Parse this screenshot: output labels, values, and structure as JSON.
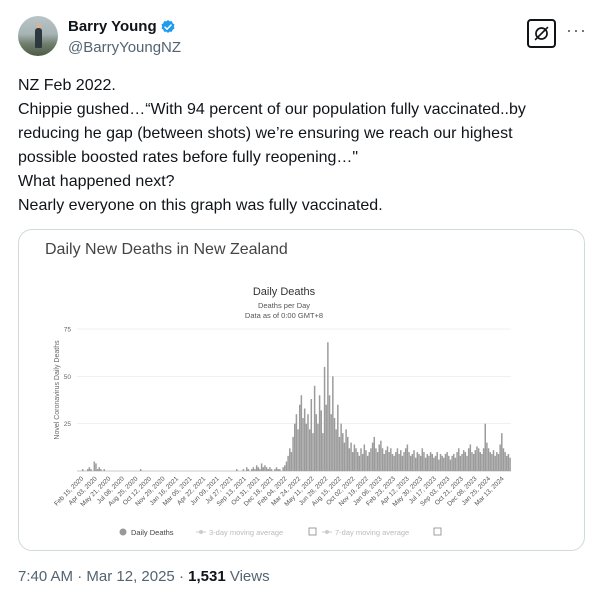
{
  "author": {
    "name": "Barry Young",
    "handle": "@BarryYoungNZ",
    "verified": true
  },
  "tweet": {
    "lines": [
      "NZ Feb 2022.",
      "Chippie gushed…“With 94 percent of our population fully vaccinated..by",
      "reducing he gap (between shots) we’re ensuring we reach our highest",
      "possible boosted rates before fully reopening…\"",
      "What happened next?",
      "Nearly everyone on this graph was fully vaccinated."
    ],
    "time": "7:40 AM",
    "date": "Mar 12, 2025",
    "views": "1,531",
    "views_label": "Views"
  },
  "card": {
    "heading": "Daily New Deaths in New Zealand"
  },
  "chart_data": {
    "type": "bar",
    "title": "Daily Deaths",
    "subtitle": "Deaths per Day",
    "subtitle2": "Data as of 0:00 GMT+8",
    "ylabel": "Novel Coronavirus Daily Deaths",
    "xlabel": "",
    "ylim": [
      0,
      75
    ],
    "yticks": [
      0,
      25,
      50,
      75
    ],
    "grid": true,
    "x_tick_labels": [
      "Feb 15, 2020",
      "Apr 03, 2020",
      "May 21, 2020",
      "Jul 08, 2020",
      "Aug 25, 2020",
      "Oct 12, 2020",
      "Nov 29, 2020",
      "Jan 16, 2021",
      "Mar 05, 2021",
      "Apr 22, 2021",
      "Jun 09, 2021",
      "Jul 27, 2021",
      "Sep 13, 2021",
      "Oct 31, 2021",
      "Dec 18, 2021",
      "Feb 04, 2022",
      "Mar 24, 2022",
      "May 11, 2022",
      "Jun 28, 2022",
      "Aug 15, 2022",
      "Oct 02, 2022",
      "Nov 19, 2022",
      "Jan 06, 2023",
      "Feb 23, 2023",
      "Apr 12, 2023",
      "May 30, 2023",
      "Jul 17, 2023",
      "Sep 03, 2023",
      "Oct 21, 2023",
      "Dec 08, 2023",
      "Jan 25, 2024",
      "Mar 13, 2024"
    ],
    "legend": [
      "Daily Deaths",
      "3-day moving average",
      "7-day moving average"
    ],
    "legend_position": "bottom",
    "series": [
      {
        "name": "Daily Deaths",
        "values": [
          0,
          0,
          0,
          1,
          0,
          0,
          1,
          2,
          1,
          0,
          5,
          4,
          1,
          2,
          1,
          0,
          1,
          0,
          0,
          0,
          0,
          0,
          0,
          0,
          0,
          0,
          0,
          0,
          0,
          0,
          0,
          0,
          0,
          0,
          0,
          0,
          0,
          0,
          1,
          0,
          0,
          0,
          0,
          0,
          0,
          0,
          0,
          0,
          0,
          0,
          0,
          0,
          0,
          0,
          0,
          0,
          0,
          0,
          0,
          0,
          0,
          0,
          0,
          0,
          0,
          0,
          0,
          0,
          0,
          0,
          0,
          0,
          0,
          0,
          0,
          0,
          0,
          0,
          0,
          0,
          0,
          0,
          0,
          0,
          0,
          0,
          0,
          0,
          0,
          0,
          0,
          0,
          0,
          0,
          0,
          0,
          1,
          0,
          0,
          0,
          1,
          0,
          2,
          1,
          0,
          1,
          2,
          1,
          3,
          2,
          1,
          4,
          2,
          3,
          2,
          1,
          2,
          1,
          0,
          1,
          2,
          1,
          1,
          0,
          2,
          3,
          5,
          8,
          12,
          10,
          18,
          25,
          30,
          22,
          35,
          40,
          28,
          33,
          25,
          30,
          22,
          38,
          20,
          45,
          30,
          25,
          40,
          32,
          20,
          55,
          35,
          68,
          40,
          30,
          50,
          28,
          22,
          35,
          18,
          25,
          20,
          15,
          22,
          18,
          12,
          15,
          10,
          14,
          12,
          10,
          8,
          12,
          9,
          14,
          11,
          8,
          10,
          12,
          15,
          18,
          12,
          10,
          14,
          16,
          12,
          9,
          11,
          13,
          10,
          12,
          9,
          8,
          10,
          12,
          9,
          11,
          8,
          10,
          12,
          14,
          10,
          8,
          9,
          11,
          7,
          10,
          9,
          8,
          12,
          10,
          7,
          9,
          8,
          10,
          9,
          7,
          8,
          10,
          6,
          9,
          8,
          7,
          9,
          10,
          8,
          6,
          8,
          9,
          7,
          10,
          12,
          8,
          9,
          11,
          10,
          8,
          12,
          14,
          10,
          9,
          11,
          13,
          12,
          10,
          9,
          12,
          25,
          15,
          12,
          10,
          9,
          11,
          8,
          10,
          9,
          14,
          20,
          12,
          10,
          8,
          9,
          7
        ]
      }
    ]
  }
}
